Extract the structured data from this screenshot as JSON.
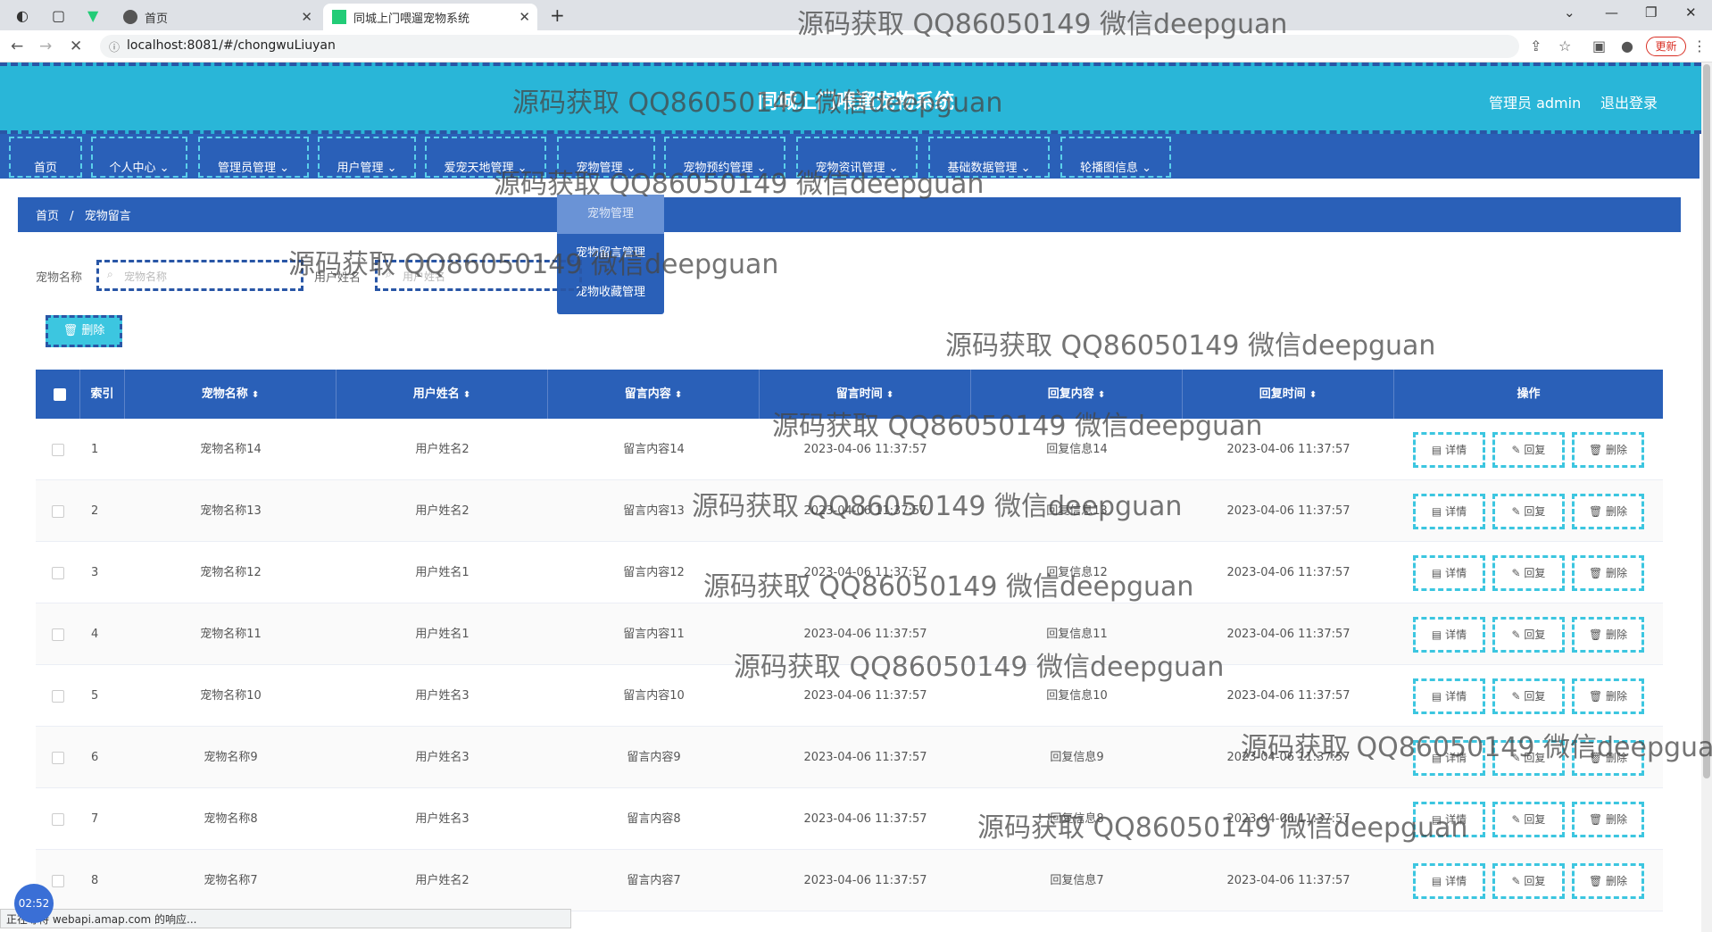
{
  "browser": {
    "tabs": [
      {
        "label": "首页",
        "active": false
      },
      {
        "label": "同城上门喂遛宠物系统",
        "active": true
      }
    ],
    "url": "localhost:8081/#/chongwuLiuyan",
    "update_label": "更新"
  },
  "header": {
    "title": "同城上门喂遛宠物系统",
    "user": "管理员 admin",
    "logout": "退出登录"
  },
  "menu": [
    "首页",
    "个人中心",
    "管理员管理",
    "用户管理",
    "爱宠天地管理",
    "宠物管理",
    "宠物预约管理",
    "宠物资讯管理",
    "基础数据管理",
    "轮播图信息"
  ],
  "dropdown": [
    "宠物管理",
    "宠物留言管理",
    "宠物收藏管理"
  ],
  "breadcrumb": {
    "home": "首页",
    "sep": "/",
    "current": "宠物留言"
  },
  "filters": [
    {
      "label": "宠物名称",
      "placeholder": "宠物名称"
    },
    {
      "label": "用户姓名",
      "placeholder": "用户姓名"
    }
  ],
  "delete_button": "删除",
  "table": {
    "columns": [
      "索引",
      "宠物名称",
      "用户姓名",
      "留言内容",
      "留言时间",
      "回复内容",
      "回复时间",
      "操作"
    ],
    "actions": [
      "详情",
      "回复",
      "删除"
    ],
    "rows": [
      {
        "idx": "1",
        "pet": "宠物名称14",
        "user": "用户姓名2",
        "msg": "留言内容14",
        "time": "2023-04-06 11:37:57",
        "reply": "回复信息14",
        "rtime": "2023-04-06 11:37:57"
      },
      {
        "idx": "2",
        "pet": "宠物名称13",
        "user": "用户姓名2",
        "msg": "留言内容13",
        "time": "2023-04-06 11:37:57",
        "reply": "回复信息13",
        "rtime": "2023-04-06 11:37:57"
      },
      {
        "idx": "3",
        "pet": "宠物名称12",
        "user": "用户姓名1",
        "msg": "留言内容12",
        "time": "2023-04-06 11:37:57",
        "reply": "回复信息12",
        "rtime": "2023-04-06 11:37:57"
      },
      {
        "idx": "4",
        "pet": "宠物名称11",
        "user": "用户姓名1",
        "msg": "留言内容11",
        "time": "2023-04-06 11:37:57",
        "reply": "回复信息11",
        "rtime": "2023-04-06 11:37:57"
      },
      {
        "idx": "5",
        "pet": "宠物名称10",
        "user": "用户姓名3",
        "msg": "留言内容10",
        "time": "2023-04-06 11:37:57",
        "reply": "回复信息10",
        "rtime": "2023-04-06 11:37:57"
      },
      {
        "idx": "6",
        "pet": "宠物名称9",
        "user": "用户姓名3",
        "msg": "留言内容9",
        "time": "2023-04-06 11:37:57",
        "reply": "回复信息9",
        "rtime": "2023-04-06 11:37:57"
      },
      {
        "idx": "7",
        "pet": "宠物名称8",
        "user": "用户姓名3",
        "msg": "留言内容8",
        "time": "2023-04-06 11:37:57",
        "reply": "回复信息8",
        "rtime": "2023-04-06 11:37:57"
      },
      {
        "idx": "8",
        "pet": "宠物名称7",
        "user": "用户姓名2",
        "msg": "留言内容7",
        "time": "2023-04-06 11:37:57",
        "reply": "回复信息7",
        "rtime": "2023-04-06 11:37:57"
      }
    ]
  },
  "watermark": "源码获取 QQ86050149 微信deepguan",
  "timer": "02:52",
  "status_text": "正在等待 webapi.amap.com 的响应..."
}
